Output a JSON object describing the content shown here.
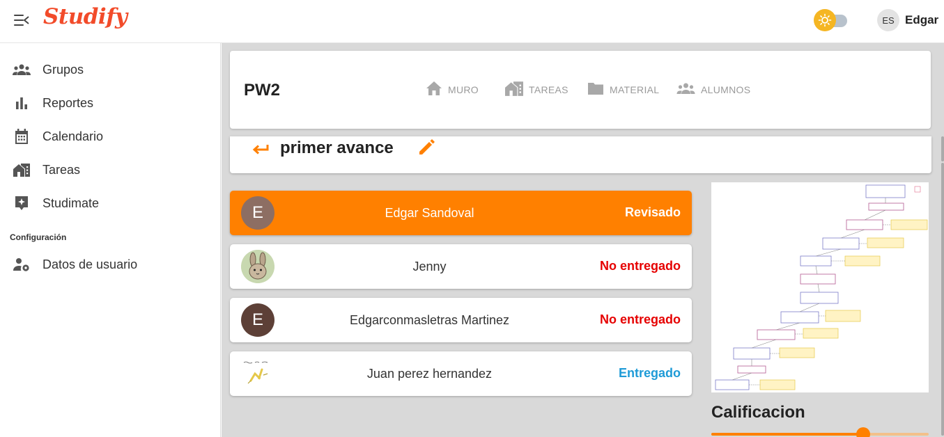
{
  "app": {
    "brand": "Studify",
    "language_badge": "ES",
    "user_name": "Edgar",
    "theme_icon": "sun-icon"
  },
  "sidebar": {
    "items": [
      {
        "label": "Grupos",
        "icon": "groups-icon"
      },
      {
        "label": "Reportes",
        "icon": "bar-chart-icon"
      },
      {
        "label": "Calendario",
        "icon": "calendar-icon"
      },
      {
        "label": "Tareas",
        "icon": "tasks-building-icon"
      },
      {
        "label": "Studimate",
        "icon": "sparkle-badge-icon"
      }
    ],
    "section_title": "Configuración",
    "config_items": [
      {
        "label": "Datos de usuario",
        "icon": "user-settings-icon"
      }
    ]
  },
  "class": {
    "title": "PW2",
    "tabs": [
      {
        "label": "MURO",
        "icon": "home-icon"
      },
      {
        "label": "TAREAS",
        "icon": "tasks-building-icon"
      },
      {
        "label": "MATERIAL",
        "icon": "folder-icon"
      },
      {
        "label": "ALUMNOS",
        "icon": "groups-icon"
      }
    ]
  },
  "assignment": {
    "title": "primer avance"
  },
  "students": [
    {
      "name": "Edgar Sandoval",
      "status": "Revisado",
      "avatar_letter": "E",
      "avatar_color": "#8d6e63",
      "status_color": "#ffffff"
    },
    {
      "name": "Jenny",
      "status": "No entregado",
      "avatar_letter": "",
      "avatar_color": "#c8d8b0",
      "status_color": "#e60000"
    },
    {
      "name": "Edgarconmasletras Martinez",
      "status": "No entregado",
      "avatar_letter": "E",
      "avatar_color": "#5d4037",
      "status_color": "#e60000"
    },
    {
      "name": "Juan perez hernandez",
      "status": "Entregado",
      "avatar_letter": "",
      "avatar_color": "#ffffff",
      "status_color": "#1e9bd7"
    }
  ],
  "grading": {
    "label": "Calificacion",
    "value_fraction": 0.7
  },
  "colors": {
    "accent": "#ff8000",
    "brand": "#f24b2a",
    "not_submitted": "#e60000",
    "submitted": "#1e9bd7"
  }
}
